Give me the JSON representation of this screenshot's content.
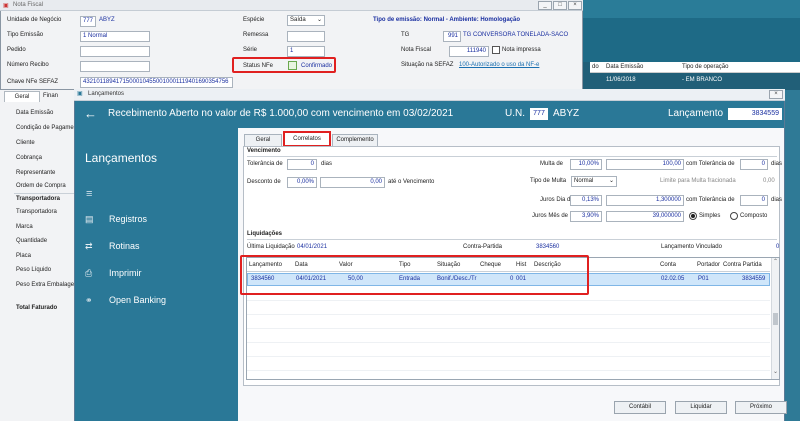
{
  "bg": {
    "title": "Nota Fiscal",
    "fields": {
      "unidade_label": "Unidade de Negócio",
      "unidade_code": "777",
      "unidade_name": "ABYZ",
      "tipo_emissao_label": "Tipo Emissão",
      "tipo_emissao_value": "1 Normal",
      "pedido_label": "Pedido",
      "numero_recibo_label": "Número Recibo",
      "chave_label": "Chave NFe SEFAZ",
      "chave_value": "43210118941715000104550010001119401690354756",
      "especie_label": "Espécie",
      "especie_value": "Saída",
      "remessa_label": "Remessa",
      "serie_label": "Série",
      "serie_value": "1",
      "status_label": "Status NFe",
      "status_value": "Confirmado",
      "tipo_emissao_header": "Tipo de emissão: Normal - Ambiente: Homologação",
      "tg_label": "TG",
      "tg_code": "991",
      "tg_name": "TG CONVERSORA TONELADA-SACO",
      "nota_fiscal_label": "Nota Fiscal",
      "nota_fiscal_value": "111940",
      "nota_impressa_label": "Nota impressa",
      "situacao_label": "Situação na SEFAZ",
      "situacao_value": "100-Autorizado o uso da NF-e"
    },
    "grid_headers": [
      "do",
      "Data Emissão",
      "Tipo de operação"
    ],
    "grid_row": [
      "",
      "11/06/2018",
      "- EM BRANCO"
    ],
    "side_tabs": [
      "Geral",
      "Finan"
    ],
    "side_items": [
      "Data Emissão",
      "Condição de Pagame",
      "Cliente",
      "Cobrança",
      "Representante",
      "Ordem de Compra",
      "Transportadora",
      "Transportadora",
      "Marca",
      "Quantidade",
      "Placa",
      "Peso Líquido",
      "Peso Extra Embalage",
      "Total Faturado"
    ]
  },
  "dialog": {
    "title": "Lançamentos",
    "header": {
      "title": "Recebimento Aberto no valor de R$ 1.000,00 com vencimento em 03/02/2021",
      "un_label": "U.N.",
      "un_code": "777",
      "un_name": "ABYZ",
      "lancamento_label": "Lançamento",
      "lancamento_value": "3834559"
    },
    "nav": {
      "heading": "Lançamentos",
      "items": [
        {
          "label": "Registros",
          "icon": "book-icon"
        },
        {
          "label": "Rotinas",
          "icon": "swap-icon"
        },
        {
          "label": "Imprimir",
          "icon": "printer-icon"
        },
        {
          "label": "Open Banking",
          "icon": "network-icon"
        }
      ]
    },
    "tabs": [
      "Geral",
      "Correlatos",
      "Complemento"
    ],
    "vencimento": {
      "section": "Vencimento",
      "tolerancia_label": "Tolerância de",
      "tolerancia_value": "0",
      "tolerancia_unit": "dias",
      "desconto_label": "Desconto de",
      "desconto_pct": "0,00%",
      "desconto_value": "0,00",
      "desconto_suffix": "até o Vencimento",
      "multa_label": "Multa de",
      "multa_pct": "10,00%",
      "multa_value": "100,00",
      "multa_tol_label": "com Tolerância de",
      "multa_tol_value": "0",
      "multa_tol_unit": "dias",
      "tipo_multa_label": "Tipo de Multa",
      "tipo_multa_value": "Normal",
      "limite_label": "Limite para Multa fracionada",
      "limite_value": "0,00",
      "juros_dia_label": "Juros Dia de",
      "juros_dia_pct": "0,13%",
      "juros_dia_value": "1,300000",
      "juros_tol_label": "com Tolerância de",
      "juros_tol_value": "0",
      "juros_tol_unit": "dias",
      "juros_mes_label": "Juros Mês de",
      "juros_mes_pct": "3,90%",
      "juros_mes_value": "39,000000",
      "simples_label": "Simples",
      "composto_label": "Composto"
    },
    "liquidacoes": {
      "section": "Liquidações",
      "ultima_label": "Última Liquidação",
      "ultima_value": "04/01/2021",
      "contra_partida_label": "Contra-Partida",
      "contra_partida_value": "3834560",
      "vinculado_label": "Lançamento Vinculado",
      "vinculado_value": "0"
    },
    "grid": {
      "headers": [
        "Lançamento",
        "Data",
        "Valor",
        "Tipo",
        "Situação",
        "Cheque",
        "Hist",
        "Descrição",
        "Conta",
        "Portador",
        "Contra Partida"
      ],
      "row": [
        "3834560",
        "04/01/2021",
        "50,00",
        "Entrada",
        "Bonif./Desc./Tr",
        "0",
        "001",
        "",
        "02.02.05",
        "P01",
        "3834559"
      ]
    },
    "buttons": [
      "Contábil",
      "Liquidar",
      "Próximo"
    ]
  },
  "colors": {
    "accent": "#2a7897",
    "highlight_box": "#e02020",
    "selected_row": "#cfe6fa",
    "value_blue": "#1a2fa0"
  }
}
